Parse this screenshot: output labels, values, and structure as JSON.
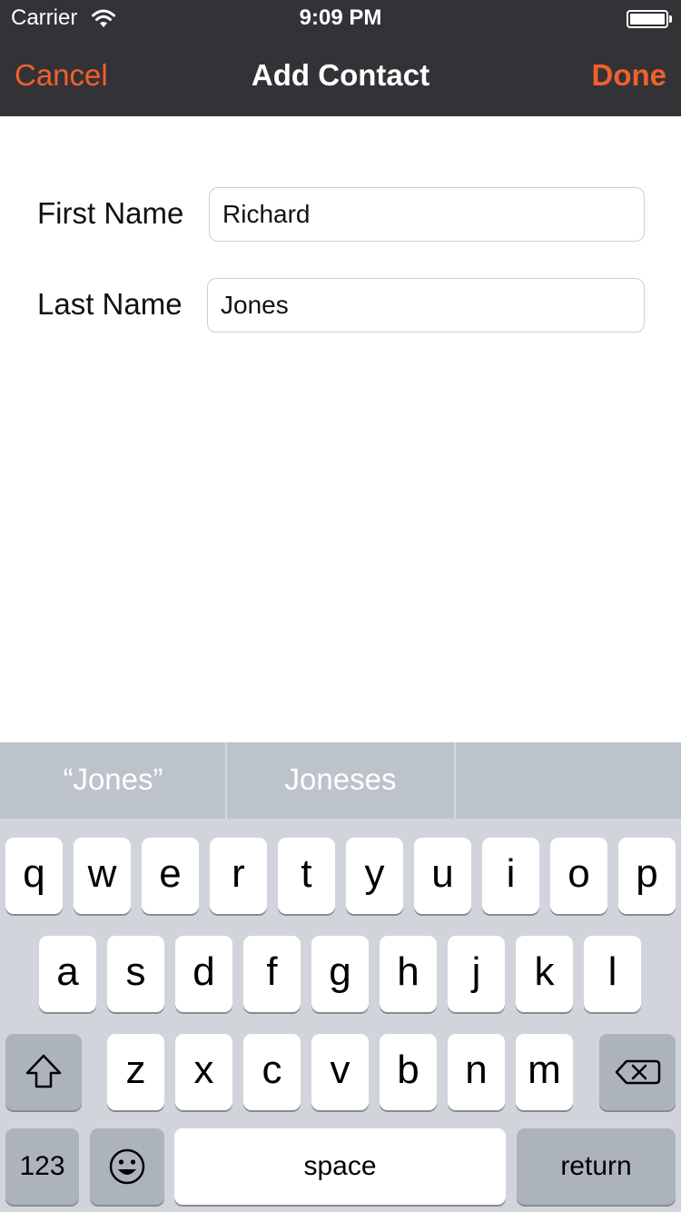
{
  "status_bar": {
    "carrier": "Carrier",
    "time": "9:09 PM",
    "wifi_icon": "wifi-icon",
    "battery_icon": "battery-icon"
  },
  "nav": {
    "cancel": "Cancel",
    "title": "Add Contact",
    "done": "Done",
    "accent_color": "#f0602b",
    "bar_color": "#333337"
  },
  "form": {
    "first_name_label": "First Name",
    "first_name_value": "Richard",
    "last_name_label": "Last Name",
    "last_name_value": "Jones"
  },
  "keyboard": {
    "suggestions": [
      "“Jones”",
      "Joneses",
      ""
    ],
    "row1": [
      "q",
      "w",
      "e",
      "r",
      "t",
      "y",
      "u",
      "i",
      "o",
      "p"
    ],
    "row2": [
      "a",
      "s",
      "d",
      "f",
      "g",
      "h",
      "j",
      "k",
      "l"
    ],
    "row3": [
      "z",
      "x",
      "c",
      "v",
      "b",
      "n",
      "m"
    ],
    "shift_icon": "shift-icon",
    "delete_icon": "delete-icon",
    "numbers": "123",
    "emoji_icon": "emoji-icon",
    "space": "space",
    "return": "return"
  }
}
